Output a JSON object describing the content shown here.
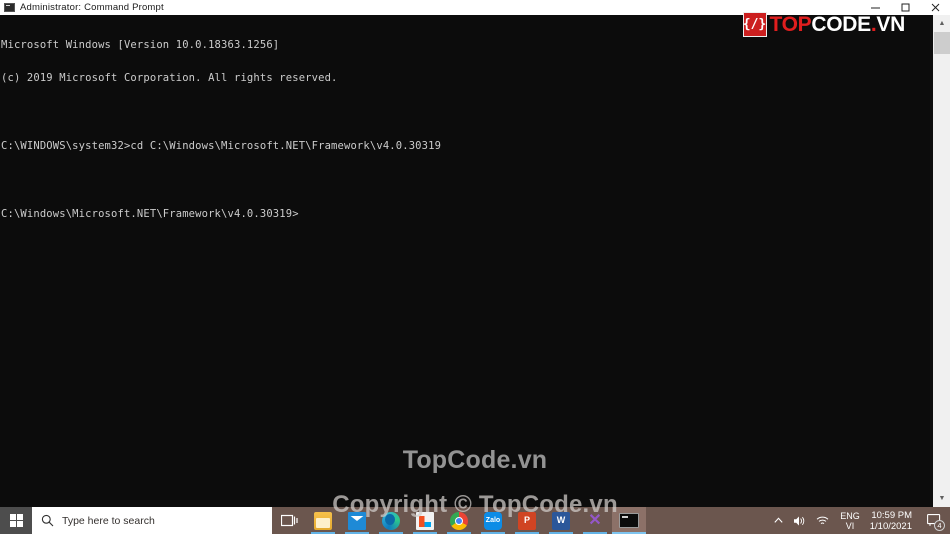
{
  "window": {
    "title": "Administrator: Command Prompt",
    "icon": "console-icon",
    "controls": {
      "minimize": "minimize",
      "maximize": "maximize",
      "close": "close"
    }
  },
  "console": {
    "lines": [
      "Microsoft Windows [Version 10.0.18363.1256]",
      "(c) 2019 Microsoft Corporation. All rights reserved.",
      "",
      "C:\\WINDOWS\\system32>cd C:\\Windows\\Microsoft.NET\\Framework\\v4.0.30319",
      "",
      "C:\\Windows\\Microsoft.NET\\Framework\\v4.0.30319>"
    ],
    "text_color": "#cccccc",
    "background_color": "#0c0c0c"
  },
  "scrollbar": {
    "up_arrow": "▲",
    "down_arrow": "▼"
  },
  "logo": {
    "badge": "{/}",
    "word_part1": "TOP",
    "word_part2": "CODE",
    "word_dot": ".",
    "word_part3": "VN",
    "red": "#e01e1e",
    "white": "#ffffff"
  },
  "watermarks": {
    "main": "TopCode.vn",
    "copyright": "Copyright © TopCode.vn"
  },
  "taskbar": {
    "start_label": "Start",
    "search": {
      "placeholder": "Type here to search",
      "value": ""
    },
    "taskview_label": "Task View",
    "apps": [
      {
        "name": "file-explorer",
        "label": "File Explorer",
        "icon_class": "ic-explorer",
        "glyph": "",
        "active": false,
        "running": true
      },
      {
        "name": "mail",
        "label": "Mail",
        "icon_class": "ic-mail",
        "glyph": "",
        "active": false,
        "running": true
      },
      {
        "name": "microsoft-edge",
        "label": "Microsoft Edge",
        "icon_class": "ic-edge",
        "glyph": "",
        "active": false,
        "running": true
      },
      {
        "name": "microsoft-store",
        "label": "Microsoft Store",
        "icon_class": "ic-store",
        "glyph": "",
        "active": false,
        "running": true
      },
      {
        "name": "google-chrome",
        "label": "Google Chrome",
        "icon_class": "ic-chrome",
        "glyph": "",
        "active": false,
        "running": true
      },
      {
        "name": "zalo",
        "label": "Zalo",
        "icon_class": "ic-zalo",
        "glyph": "Zalo",
        "active": false,
        "running": true
      },
      {
        "name": "powerpoint",
        "label": "PowerPoint",
        "icon_class": "ic-ppt",
        "glyph": "P",
        "active": false,
        "running": true
      },
      {
        "name": "word",
        "label": "Word",
        "icon_class": "ic-word",
        "glyph": "W",
        "active": false,
        "running": true
      },
      {
        "name": "visual-studio",
        "label": "Visual Studio",
        "icon_class": "ic-vs",
        "glyph": "✕",
        "active": false,
        "running": true
      },
      {
        "name": "command-prompt",
        "label": "Command Prompt",
        "icon_class": "ic-cmd",
        "glyph": "",
        "active": true,
        "running": true
      }
    ],
    "tray": {
      "show_hidden": "⌃",
      "volume": "volume-icon",
      "network": "wifi-icon",
      "language_top": "ENG",
      "language_bottom": "VI",
      "time": "10:59 PM",
      "date": "1/10/2021",
      "notifications_count": "4"
    },
    "background_color": "#6b564e"
  }
}
